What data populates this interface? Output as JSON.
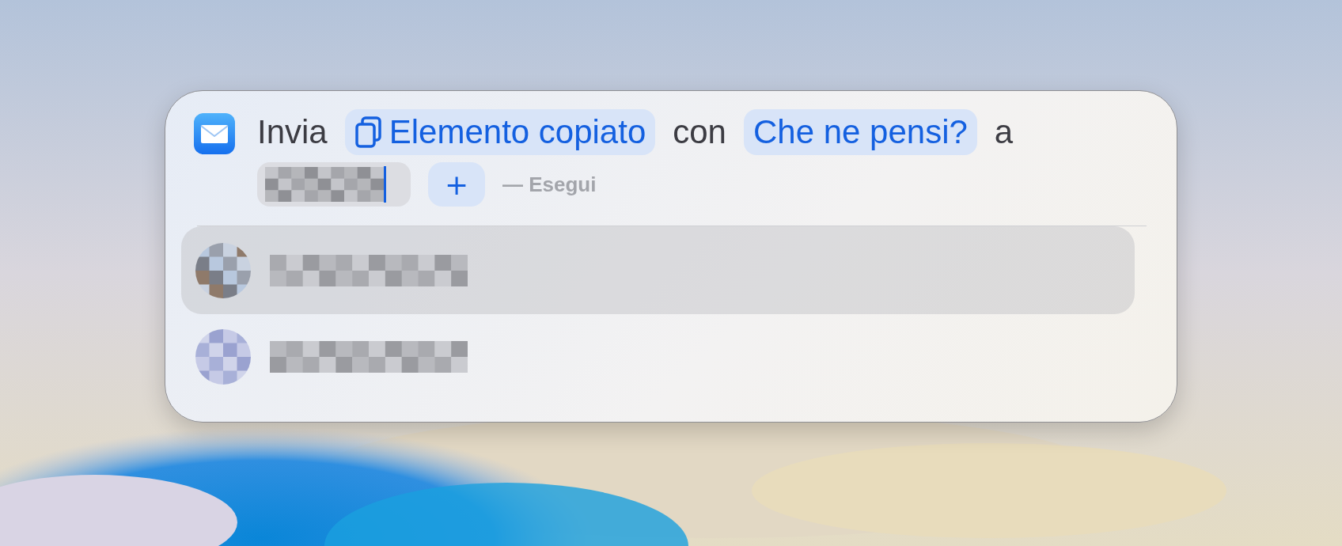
{
  "sentence": [
    {
      "kind": "word",
      "text": "Invia"
    },
    {
      "kind": "variable",
      "text": "Elemento copiato"
    },
    {
      "kind": "word",
      "text": "con"
    },
    {
      "kind": "token",
      "text": "Che ne pensi?"
    },
    {
      "kind": "word",
      "text": "a"
    }
  ],
  "add_button": {
    "label": "+"
  },
  "hint": "— Esegui",
  "suggestions": [
    {
      "selected": true
    },
    {
      "selected": false
    }
  ]
}
